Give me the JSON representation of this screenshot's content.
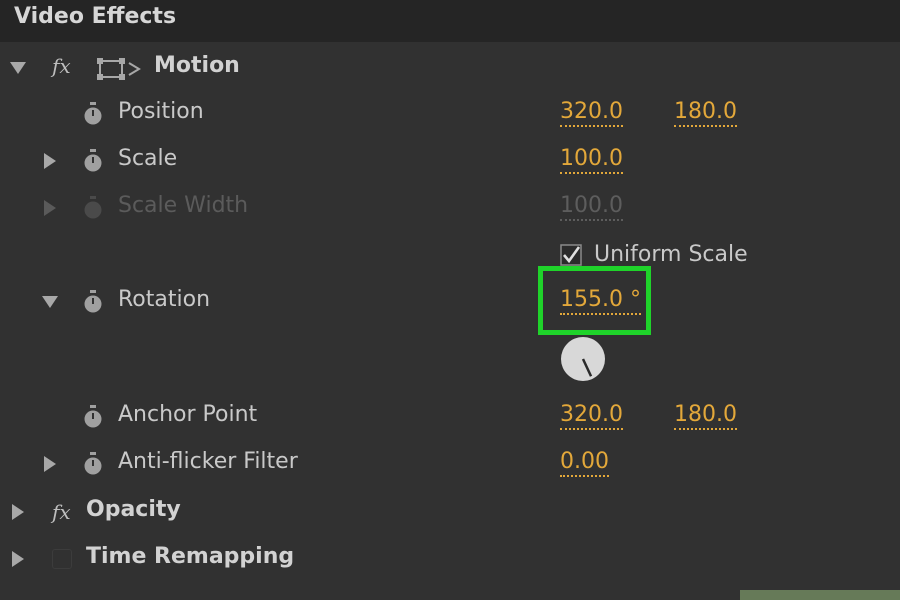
{
  "panel": {
    "title": "Video Effects"
  },
  "motion": {
    "label": "Motion",
    "fx": "fx",
    "position": {
      "label": "Position",
      "x": "320.0",
      "y": "180.0"
    },
    "scale": {
      "label": "Scale",
      "value": "100.0"
    },
    "scale_width": {
      "label": "Scale Width",
      "value": "100.0"
    },
    "uniform_scale": {
      "label": "Uniform Scale",
      "checked": true
    },
    "rotation": {
      "label": "Rotation",
      "value": "155.0 °",
      "dial_degrees": 155
    },
    "anchor_point": {
      "label": "Anchor Point",
      "x": "320.0",
      "y": "180.0"
    },
    "anti_flicker": {
      "label": "Anti-flicker Filter",
      "value": "0.00"
    }
  },
  "opacity": {
    "label": "Opacity",
    "fx": "fx"
  },
  "time_remapping": {
    "label": "Time Remapping"
  },
  "colors": {
    "value": "#e3a83a",
    "highlight": "#1fd32a",
    "panel": "#313131"
  }
}
